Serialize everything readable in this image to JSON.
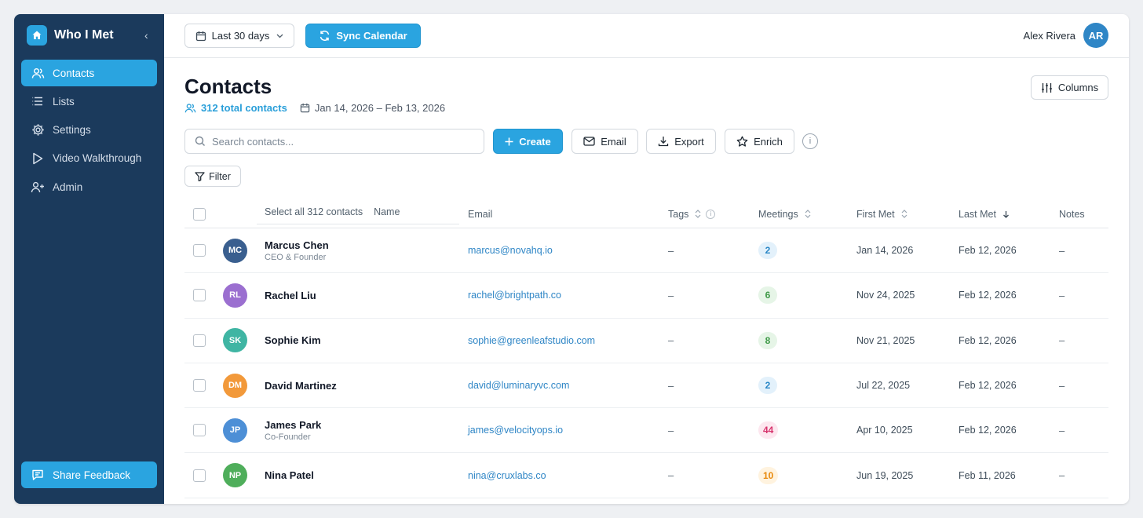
{
  "brand": {
    "name": "Who I Met",
    "collapse_glyph": "‹"
  },
  "sidebar": {
    "items": [
      {
        "label": "Contacts",
        "icon": "users-icon",
        "active": true
      },
      {
        "label": "Lists",
        "icon": "list-icon",
        "active": false
      },
      {
        "label": "Settings",
        "icon": "gear-icon",
        "active": false
      },
      {
        "label": "Video Walkthrough",
        "icon": "play-icon",
        "active": false
      },
      {
        "label": "Admin",
        "icon": "user-plus-icon",
        "active": false
      }
    ],
    "feedback_label": "Share Feedback"
  },
  "topbar": {
    "date_range_label": "Last 30 days",
    "sync_label": "Sync Calendar",
    "user_name": "Alex Rivera",
    "user_initials": "AR"
  },
  "page": {
    "title": "Contacts",
    "total_label": "312 total contacts",
    "date_range": "Jan 14, 2026 – Feb 13, 2026",
    "columns_label": "Columns"
  },
  "toolbar": {
    "search_placeholder": "Search contacts...",
    "create_label": "Create",
    "email_label": "Email",
    "export_label": "Export",
    "enrich_label": "Enrich",
    "info_glyph": "i",
    "filter_label": "Filter"
  },
  "table": {
    "select_all_label": "Select all 312 contacts",
    "headers": {
      "name": "Name",
      "email": "Email",
      "tags": "Tags",
      "meetings": "Meetings",
      "first_met": "First Met",
      "last_met": "Last Met",
      "notes": "Notes"
    },
    "rows": [
      {
        "initials": "MC",
        "name": "Marcus Chen",
        "role": "CEO & Founder",
        "email": "marcus@novahq.io",
        "tags": "–",
        "meetings": "2",
        "first_met": "Jan 14, 2026",
        "last_met": "Feb 12, 2026",
        "notes": "–"
      },
      {
        "initials": "RL",
        "name": "Rachel Liu",
        "role": "",
        "email": "rachel@brightpath.co",
        "tags": "–",
        "meetings": "6",
        "first_met": "Nov 24, 2025",
        "last_met": "Feb 12, 2026",
        "notes": "–"
      },
      {
        "initials": "SK",
        "name": "Sophie Kim",
        "role": "",
        "email": "sophie@greenleafstudio.com",
        "tags": "–",
        "meetings": "8",
        "first_met": "Nov 21, 2025",
        "last_met": "Feb 12, 2026",
        "notes": "–"
      },
      {
        "initials": "DM",
        "name": "David Martinez",
        "role": "",
        "email": "david@luminaryvc.com",
        "tags": "–",
        "meetings": "2",
        "first_met": "Jul 22, 2025",
        "last_met": "Feb 12, 2026",
        "notes": "–"
      },
      {
        "initials": "JP",
        "name": "James Park",
        "role": "Co-Founder",
        "email": "james@velocityops.io",
        "tags": "–",
        "meetings": "44",
        "first_met": "Apr 10, 2025",
        "last_met": "Feb 12, 2026",
        "notes": "–"
      },
      {
        "initials": "NP",
        "name": "Nina Patel",
        "role": "",
        "email": "nina@cruxlabs.co",
        "tags": "–",
        "meetings": "10",
        "first_met": "Jun 19, 2025",
        "last_met": "Feb 11, 2026",
        "notes": "–"
      }
    ]
  },
  "colors": {
    "sidebar_bg": "#1b3a5c",
    "accent": "#2aa4e0",
    "avatar_colors": [
      "#3a5f8f",
      "#9b6fd0",
      "#3fb5a3",
      "#f2993a",
      "#4d8fd6",
      "#4fae5b"
    ],
    "badge_styles": [
      {
        "bg": "#e3f1fb",
        "fg": "#2a87c6"
      },
      {
        "bg": "#e6f5e7",
        "fg": "#3f9a48"
      },
      {
        "bg": "#e6f5e7",
        "fg": "#3f9a48"
      },
      {
        "bg": "#e3f1fb",
        "fg": "#2a87c6"
      },
      {
        "bg": "#fde7ef",
        "fg": "#d6336c"
      },
      {
        "bg": "#fff3df",
        "fg": "#e8890c"
      }
    ]
  }
}
